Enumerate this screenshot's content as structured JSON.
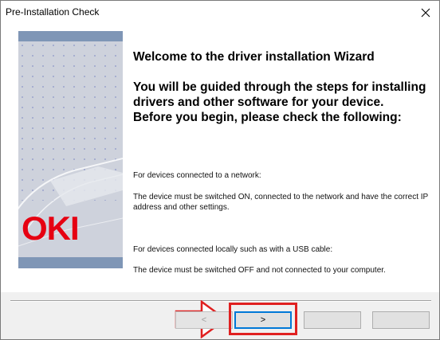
{
  "window": {
    "title": "Pre-Installation Check"
  },
  "side_image": {
    "logo_text": "OKI",
    "logo_color": "#e60012"
  },
  "main": {
    "heading1": "Welcome to the driver installation Wizard",
    "heading2": "You will be guided through the steps for installing drivers and other software for your device.",
    "heading3": "Before you begin, please check the following:",
    "network_label": "For devices connected to a network:",
    "network_text": "The device must be switched ON, connected to the network and have the correct IP address and other settings.",
    "local_label": "For devices connected locally such as with a USB cable:",
    "local_text": "The device must be switched OFF and not connected to your computer."
  },
  "buttons": {
    "back_label": "<",
    "next_label": ">",
    "button3_label": "",
    "button4_label": ""
  },
  "annotation": {
    "highlight_color": "#e02020"
  }
}
